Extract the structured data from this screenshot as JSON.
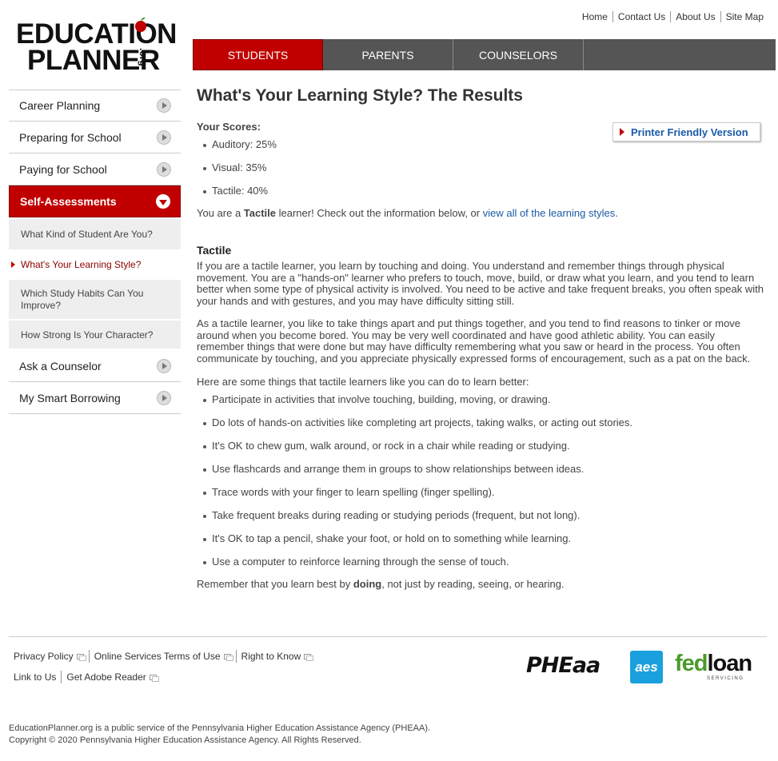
{
  "logo": {
    "line1": "EDUCATION",
    "line2": "PLANNER",
    "suffix": ".org",
    "tm": "SM"
  },
  "util_links": [
    "Home",
    "Contact Us",
    "About Us",
    "Site Map"
  ],
  "topnav": {
    "tabs": [
      "STUDENTS",
      "PARENTS",
      "COUNSELORS"
    ],
    "active": "STUDENTS",
    "active_color": "#c00000"
  },
  "sidebar": {
    "items": [
      {
        "label": "Career Planning"
      },
      {
        "label": "Preparing for School"
      },
      {
        "label": "Paying for School"
      },
      {
        "label": "Self-Assessments"
      }
    ],
    "sub_items": [
      "What Kind of Student Are You?",
      "What's Your Learning Style?",
      "Which Study Habits Can You Improve?",
      "How Strong Is Your Character?"
    ],
    "items_after": [
      {
        "label": "Ask a Counselor"
      },
      {
        "label": "My Smart Borrowing"
      }
    ]
  },
  "main": {
    "title": "What's Your Learning Style? The Results",
    "scores_label": "Your Scores:",
    "printer_label": "Printer Friendly Version",
    "scores": [
      "Auditory: 25%",
      "Visual: 35%",
      "Tactile: 40%"
    ],
    "result_pre": "You are a ",
    "result_bold": "Tactile",
    "result_mid": " learner! Check out the information below, or ",
    "result_link": "view all of the learning styles",
    "result_end": ".",
    "section_title": "Tactile",
    "para1": "If you are a tactile learner, you learn by touching and doing. You understand and remember things through physical movement. You are a \"hands-on\" learner who prefers to touch, move, build, or draw what you learn, and you tend to learn better when some type of physical activity is involved. You need to be active and take frequent breaks, you often speak with your hands and with gestures, and you may have difficulty sitting still.",
    "para2": "As a tactile learner, you like to take things apart and put things together, and you tend to find reasons to tinker or move around when you become bored. You may be very well coordinated and have good athletic ability. You can easily remember things that were done but may have difficulty remembering what you saw or heard in the process. You often communicate by touching, and you appreciate physically expressed forms of encouragement, such as a pat on the back.",
    "tips_intro": "Here are some things that tactile learners like you can do to learn better:",
    "tips": [
      "Participate in activities that involve touching, building, moving, or drawing.",
      "Do lots of hands-on activities like completing art projects, taking walks, or acting out stories.",
      "It's OK to chew gum, walk around, or rock in a chair while reading or studying.",
      "Use flashcards and arrange them in groups to show relationships between ideas.",
      "Trace words with your finger to learn spelling (finger spelling).",
      "Take frequent breaks during reading or studying periods (frequent, but not long).",
      "It's OK to tap a pencil, shake your foot, or hold on to something while learning.",
      "Use a computer to reinforce learning through the sense of touch."
    ],
    "closing_pre": "Remember that you learn best by ",
    "closing_bold": "doing",
    "closing_end": ", not just by reading, seeing, or hearing."
  },
  "footer": {
    "row1": [
      "Privacy Policy",
      "Online Services Terms of Use",
      "Right to Know"
    ],
    "row2": [
      "Link to Us",
      "Get Adobe Reader"
    ],
    "partners": {
      "pheaa": "PHEaa",
      "aes": "aes",
      "fed": "fed",
      "loan": "loan",
      "servicing": "SERVICING"
    },
    "fine1": "EducationPlanner.org is a public service of the Pennsylvania Higher Education Assistance Agency (PHEAA).",
    "fine2": "Copyright © 2020 Pennsylvania Higher Education Assistance Agency. All Rights Reserved."
  }
}
